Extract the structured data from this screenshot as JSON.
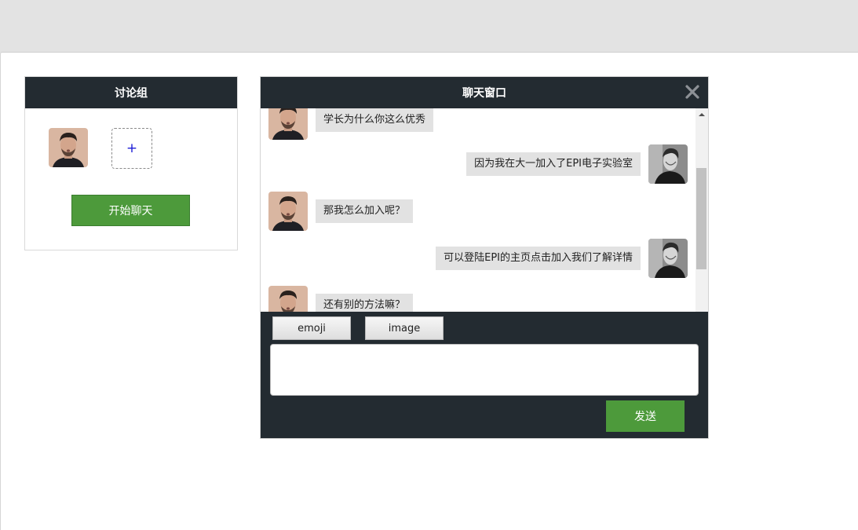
{
  "group_panel": {
    "title": "讨论组",
    "add_label": "+",
    "start_button": "开始聊天"
  },
  "chat": {
    "title": "聊天窗口",
    "messages": [
      {
        "side": "left",
        "avatar": "bearded-man-avatar",
        "text": "学长为什么你这么优秀"
      },
      {
        "side": "right",
        "avatar": "bw-man-avatar",
        "text": "因为我在大一加入了EPI电子实验室"
      },
      {
        "side": "left",
        "avatar": "bearded-man-avatar",
        "text": "那我怎么加入呢？"
      },
      {
        "side": "right",
        "avatar": "bw-man-avatar",
        "text": "可以登陆EPI的主页点击加入我们了解详情"
      },
      {
        "side": "left",
        "avatar": "bearded-man-avatar",
        "text": "还有别的方法嘛？"
      }
    ],
    "toolbar": {
      "emoji": "emoji",
      "image": "image"
    },
    "input_value": "",
    "send_button": "发送"
  },
  "colors": {
    "header_bg": "#232b31",
    "button_green": "#4d9a3b",
    "bubble_bg": "#e2e2e2",
    "page_bg": "#e3e3e3"
  },
  "icons": [
    "close-icon",
    "add-icon",
    "scroll-up-icon"
  ]
}
